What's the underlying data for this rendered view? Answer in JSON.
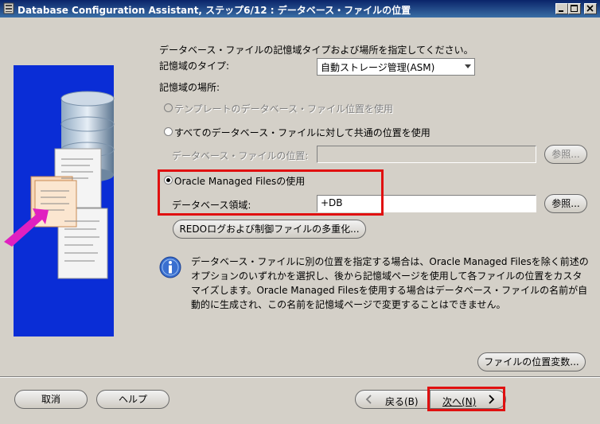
{
  "window": {
    "title": "Database Configuration Assistant, ステップ6/12 : データベース・ファイルの位置"
  },
  "main": {
    "instruction": "データベース・ファイルの記憶域タイプおよび場所を指定してください。",
    "storage_type_label": "記憶域のタイプ:",
    "storage_type_value": "自動ストレージ管理(ASM)",
    "storage_location_label": "記憶域の場所:",
    "options": {
      "template": "テンプレートのデータベース・ファイル位置を使用",
      "common": "すべてのデータベース・ファイルに対して共通の位置を使用",
      "omf": "Oracle Managed Filesの使用"
    },
    "common_location_label": "データベース・ファイルの位置:",
    "common_location_value": "",
    "browse_label": "参照...",
    "db_area_label": "データベース領域:",
    "db_area_value": "+DB",
    "browse2_label": "参照...",
    "multiplex_label": "REDOログおよび制御ファイルの多重化...",
    "info_lines": [
      "データベース・ファイルに別の位置を指定する場合は、Oracle Managed Filesを除く前述の",
      "オプションのいずれかを選択し、後から記憶域ページを使用して各ファイルの位置をカスタ",
      "マイズします。Oracle Managed Filesを使用する場合はデータベース・ファイルの名前が自",
      "動的に生成され、この名前を記憶域ページで変更することはできません。"
    ],
    "file_location_vars_label": "ファイルの位置変数..."
  },
  "footer": {
    "cancel": "取消",
    "help": "ヘルプ",
    "back": "戻る(B)",
    "next": "次へ(N)"
  },
  "colors": {
    "highlight_box": "#e01010",
    "illustration_bg": "#0a2dd6",
    "titlebar": "#0a246a"
  },
  "icons": [
    "app-icon",
    "minimize-icon",
    "maximize-icon",
    "close-icon",
    "info-icon",
    "database-icon",
    "chevron-left-icon",
    "chevron-right-icon"
  ]
}
